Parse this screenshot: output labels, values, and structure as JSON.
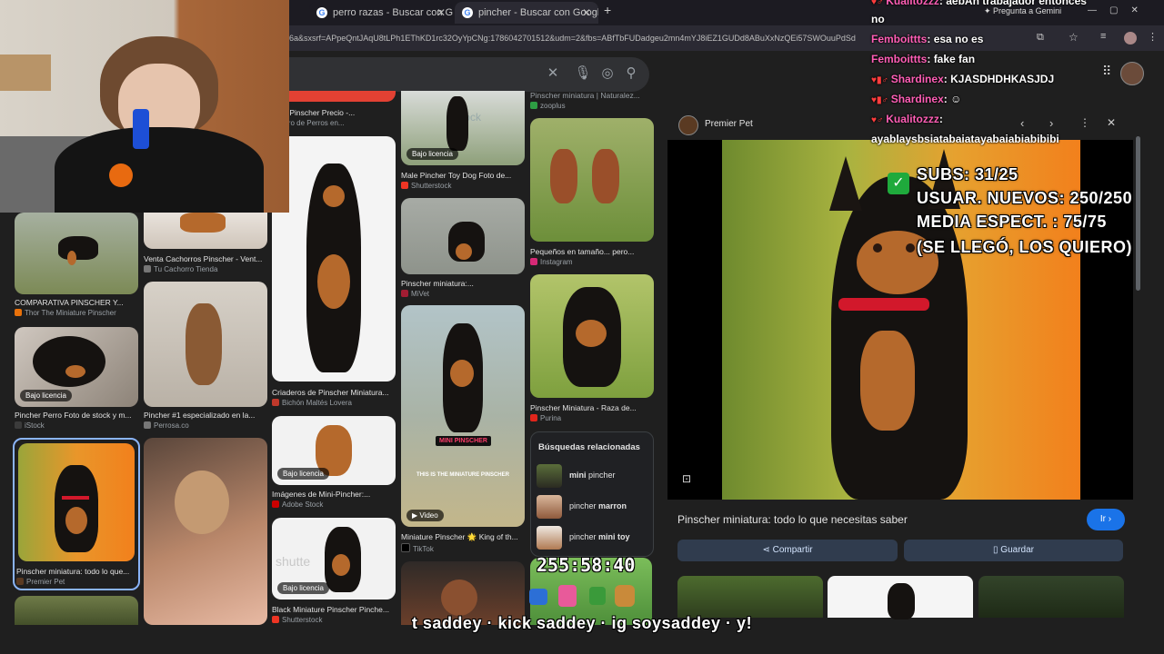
{
  "browser": {
    "tabs": [
      {
        "title": "perro razas - Buscar con Google",
        "active": false
      },
      {
        "title": "pincher - Buscar con Google",
        "active": true
      }
    ],
    "new_tab": "+",
    "url": "6a&sxsrf=APpeQntJAqU8tLPh1EThKD1rc32OyYpCNg:1786042701512&udm=2&fbs=ABfTbFUDadgeu2mn4mYJ8iEZ1GUDd8ABuXxNzQEi57SWOuuPdSd",
    "gemini": "Pregunta a Gemini",
    "window_controls": [
      "—",
      "▢",
      "✕"
    ]
  },
  "search": {
    "clear": "✕"
  },
  "grid": {
    "col1": [
      {
        "title": "COMPARATIVA PINSCHER Y...",
        "source": "Thor The Miniature Pinscher",
        "src_color": "#e8710a"
      },
      {
        "title": "Pincher Perro Foto de stock y m...",
        "source": "iStock",
        "badge": "Bajo licencia",
        "src_color": "#3b3b3b"
      },
      {
        "title": "Pinscher miniatura: todo lo que...",
        "source": "Premier Pet",
        "src_color": "#5a3a22"
      }
    ],
    "col2": [
      {
        "title": "Venta Cachorros Pinscher - Vent...",
        "source": "Tu Cachorro Tienda",
        "src_color": "#777777"
      },
      {
        "title": "Pincher #1 especializado en la...",
        "source": "Perrosa.co",
        "src_color": "#777777"
      }
    ],
    "col3": [
      {
        "title": "dero Pinscher Precio -...",
        "source": "riadero de Perros en...",
        "src_color": "#777777"
      },
      {
        "title": "Criaderos de Pinscher Miniatura...",
        "source": "Bichón Maltés Lovera",
        "src_color": "#c0392b"
      },
      {
        "title": "Imágenes de Mini-Pincher:...",
        "source": "Adobe Stock",
        "badge": "Bajo licencia",
        "src_color": "#cc0000"
      },
      {
        "title": "Black Miniature Pinscher Pinche...",
        "source": "Shutterstock",
        "badge": "Bajo licencia",
        "src_color": "#ee3524"
      }
    ],
    "col4": [
      {
        "title": "Male Pincher Toy Dog Foto de...",
        "source": "Shutterstock",
        "badge": "Bajo licencia",
        "src_color": "#ee3524"
      },
      {
        "title": "Pinscher miniatura:...",
        "source": "MiVet",
        "src_color": "#a11d33"
      },
      {
        "title": "Miniature Pinscher 🌟 King of th...",
        "source": "TikTok",
        "badge": "Video",
        "caption": "MINI PINSCHER",
        "subcaption": "THIS IS THE MINIATURE PINSCHER",
        "src_color": "#000000"
      }
    ],
    "col5": [
      {
        "title": "Pinscher miniatura | Naturalez...",
        "source": "zooplus",
        "src_color": "#2e9e44"
      },
      {
        "title": "Pequeños en tamaño... pero...",
        "source": "Instagram",
        "src_color": "#d62976"
      },
      {
        "title": "Pinscher Miniatura - Raza de...",
        "source": "Purina",
        "src_color": "#e1251b"
      }
    ]
  },
  "related": {
    "heading": "Búsquedas relacionadas",
    "items": [
      {
        "bold": "mini",
        "normal": " pincher"
      },
      {
        "normal": "pincher ",
        "bold": "marron"
      },
      {
        "normal": "pincher ",
        "bold": "mini toy"
      }
    ]
  },
  "panel": {
    "source": "Premier Pet",
    "title": "Pinscher miniatura: todo lo que necesitas saber",
    "visit": "Ir",
    "share": "Compartir",
    "save": "Guardar"
  },
  "chat": [
    {
      "user": "Kualitozzz",
      "text": "aebAh trabajador entonces"
    },
    {
      "user": "",
      "text": "no"
    },
    {
      "user": "Femboittts",
      "text": "esa no es"
    },
    {
      "user": "Femboittts",
      "text": "fake fan"
    },
    {
      "user": "Shardinex",
      "text": "KJASDHDHKASJDJ"
    },
    {
      "user": "Shardinex",
      "text": ""
    },
    {
      "user": "Kualitozzz",
      "text": ""
    },
    {
      "user": "",
      "text": "ayablaysbsiatabaiatayabaiabiabibibi"
    }
  ],
  "stats": [
    "SUBS: 31/25",
    "USUAR. NUEVOS: 250/250",
    "MEDIA ESPECT. : 75/75",
    "(SE LLEGÓ, LOS QUIERO)"
  ],
  "overlay": {
    "timer": "255:58:40",
    "ticker": "t saddey · kick saddey · ig soysaddey · y!"
  },
  "colors": {
    "accent": "#8ab4f8",
    "chat_name": "#ff5fb6",
    "visit_btn": "#1a73e8"
  }
}
